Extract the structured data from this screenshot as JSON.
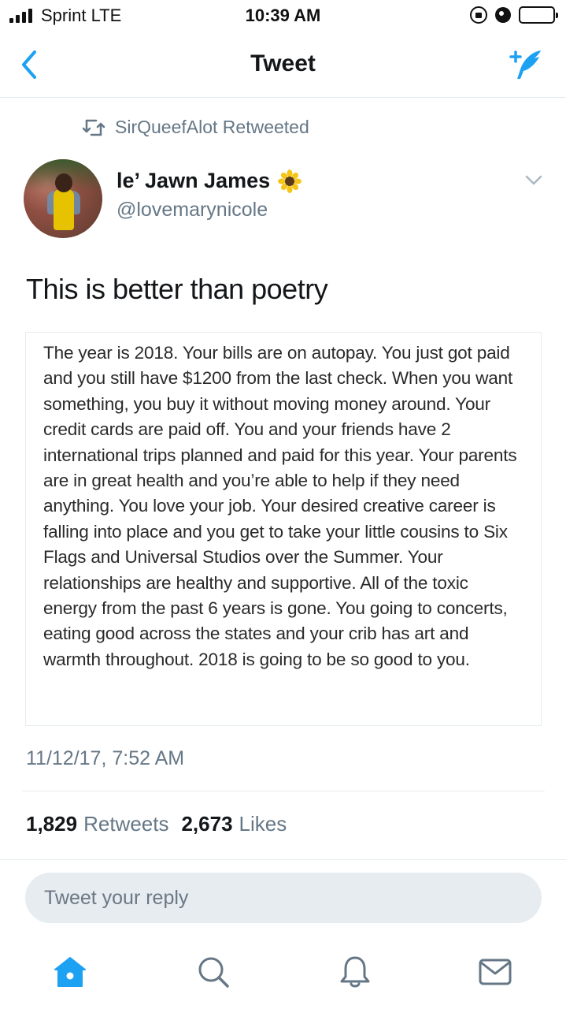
{
  "status_bar": {
    "carrier": "Sprint  LTE",
    "time": "10:39 AM",
    "battery_level": 0.55
  },
  "nav": {
    "title": "Tweet",
    "back_icon": "chevron-left-icon",
    "compose_icon": "compose-tweet-icon",
    "accent_color": "#1da1f2"
  },
  "retweet_context": {
    "text": "SirQueefAlot Retweeted",
    "icon": "retweet-icon"
  },
  "tweet": {
    "author_name": "le’ Jawn James",
    "author_emoji": "sunflower-icon",
    "author_handle": "@lovemarynicole",
    "text": "This is better than poetry",
    "image_text": "The year is 2018. Your bills are on autopay. You just got paid and you still have $1200 from the last check. When you want something, you buy it without moving money around. Your credit cards are paid off. You and your friends have 2 international trips planned and paid for this year. Your parents are in great health and you’re able to help if they need anything. You love your job. Your desired creative career is falling into place and you get to take your little cousins to Six Flags and Universal Studios over the Summer. Your relationships are healthy and supportive. All of the toxic energy from the past 6 years is gone. You going to concerts, eating good across the states and your crib has art and warmth throughout. 2018 is going to be so good to you.",
    "timestamp": "11/12/17, 7:52 AM",
    "retweets_count": "1,829",
    "retweets_label": "Retweets",
    "likes_count": "2,673",
    "likes_label": "Likes"
  },
  "reply": {
    "placeholder": "Tweet your reply"
  },
  "tab_bar": {
    "tabs": [
      {
        "icon": "home-icon",
        "active": true
      },
      {
        "icon": "search-icon",
        "active": false
      },
      {
        "icon": "notifications-bell-icon",
        "active": false
      },
      {
        "icon": "messages-envelope-icon",
        "active": false
      }
    ]
  }
}
